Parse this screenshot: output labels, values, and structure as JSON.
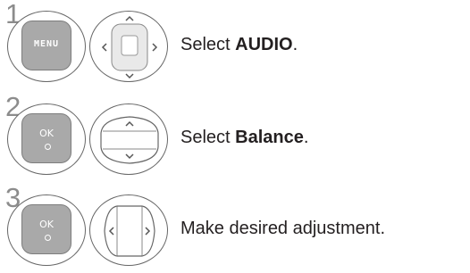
{
  "steps": [
    {
      "number": "1",
      "key_label": "MENU",
      "text_prefix": "Select ",
      "text_bold": "AUDIO",
      "text_suffix": ".",
      "nav": "four-way"
    },
    {
      "number": "2",
      "key_label": "OK",
      "text_prefix": "Select ",
      "text_bold": "Balance",
      "text_suffix": ".",
      "nav": "up-down"
    },
    {
      "number": "3",
      "key_label": "OK",
      "text_prefix": "Make desired adjustment.",
      "text_bold": "",
      "text_suffix": "",
      "nav": "left-right"
    }
  ],
  "icons": {
    "menu_key": "menu-key-icon",
    "ok_key": "ok-key-icon",
    "nav_pad": "navigation-pad-icon"
  },
  "colors": {
    "key_fill": "#a9a9a9",
    "step_number": "#8c8c8c",
    "text": "#231f20",
    "outline": "#666666"
  }
}
